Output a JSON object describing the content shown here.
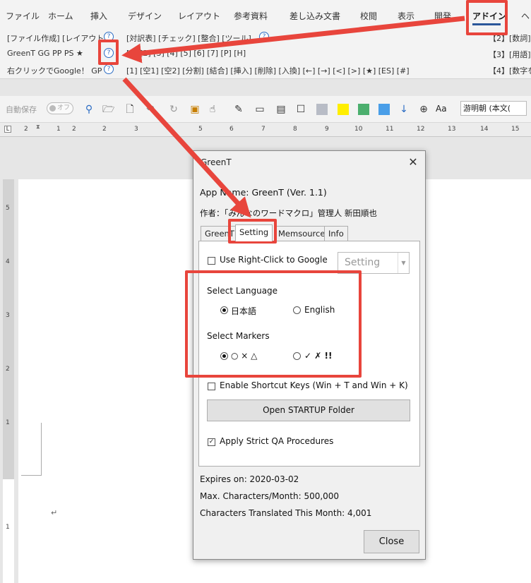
{
  "ribbon_tabs": [
    "ファイル",
    "ホーム",
    "挿入",
    "デザイン",
    "レイアウト",
    "参考資料",
    "差し込み文書",
    "校閲",
    "表示",
    "開発",
    "アドイン",
    "ヘ"
  ],
  "ribbon": {
    "row1_left": "[ファイル作成] [レイアウト]",
    "row1_mid": "[対訳表] [チェック] [整合] [ツール]",
    "row1_right": "【2】[数詞]",
    "row2_left": "GreenT  GG  PP  PS  ★",
    "row2_mid": "[1] [2] [3] [4] [5] [6] [7] [P] [H]",
    "row2_right": "【3】[用語]",
    "row3_left": "右クリックでGoogle！  GP",
    "row3_mid": "[1] [空1] [空2] [分割] [結合] [挿入] [削除] [入換] [←] [→] [<] [>] [★] [ES] [#]",
    "row3_right": "【4】[数字を",
    "help_glyph": "?"
  },
  "qat": {
    "autosave_label": "自動保存",
    "autosave_state": "オフ",
    "font_name": "游明朝 (本文(",
    "aa_label": "Aa",
    "swatch_colors": [
      "#b8bcc6",
      "#ffee00",
      "#4caf6e",
      "#4a9ee8"
    ]
  },
  "ruler": {
    "numbers": [
      "2",
      "1",
      "1",
      "2",
      "3",
      "4",
      "5",
      "6",
      "7",
      "8",
      "9",
      "10",
      "11",
      "12",
      "13",
      "14",
      "15"
    ],
    "vertical_numbers": [
      "5",
      "4",
      "3",
      "2",
      "1",
      "1"
    ]
  },
  "document": {
    "paragraph_mark": "↵"
  },
  "dialog": {
    "title": "GreenT",
    "close_glyph": "✕",
    "app_name": "App Name: GreenT (Ver. 1.1)",
    "author": "作者：「みんなのワードマクロ」管理人  新田順也",
    "tabs": [
      "GreenT",
      "Setting",
      "Memsource",
      "Info"
    ],
    "right_click_label": "Use Right-Click to Google",
    "setting_dropdown": "Setting",
    "select_language_label": "Select Language",
    "language_options": [
      "日本語",
      "English"
    ],
    "select_markers_label": "Select Markers",
    "marker_options": [
      "○ × △",
      "✓ ✗ !!"
    ],
    "shortcut_label": "Enable Shortcut Keys (Win + T and Win + K)",
    "open_startup_button": "Open STARTUP Folder",
    "strict_qa_label": "Apply Strict QA Procedures",
    "expires": "Expires on: 2020-03-02",
    "max_chars": "Max. Characters/Month: 500,000",
    "chars_translated": "Characters Translated This Month: 4,001",
    "close_button": "Close",
    "checked_glyph": "✓",
    "right_click_checked": false,
    "shortcut_checked": false,
    "strict_qa_checked": true,
    "selected_language": "日本語",
    "selected_marker": "○ × △"
  },
  "colors": {
    "highlight": "#e8453c",
    "word_blue": "#2b579a"
  }
}
